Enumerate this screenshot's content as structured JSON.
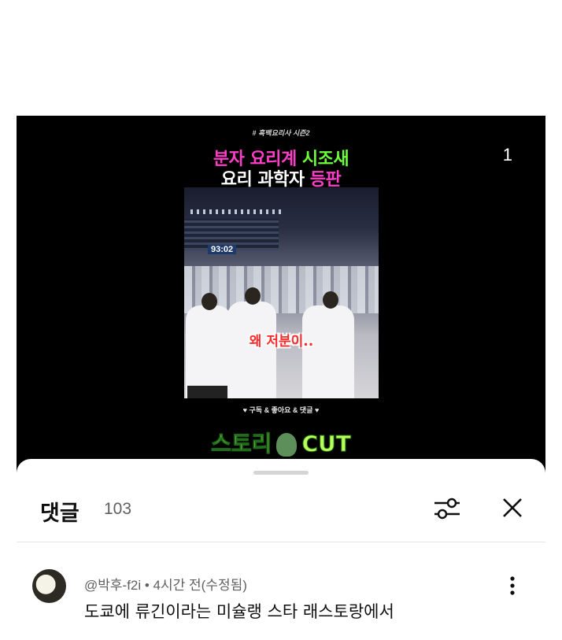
{
  "video": {
    "hashtag": "# 흑백요리사 시즌2",
    "title_line1": {
      "part1": "분자 요리계",
      "part2": "시조새"
    },
    "title_line2": {
      "part1": "요리 과학자",
      "part2": "등판"
    },
    "page_counter": "1",
    "timer": "93:02",
    "frame_caption": "왜 저분이..",
    "subscribe_line": "♥ 구독 & 좋아요 & 댓글 ♥",
    "logo": {
      "left": "스토리",
      "right": "CUT"
    }
  },
  "comments_sheet": {
    "title": "댓글",
    "count": "103",
    "comment": {
      "meta": "@박후-f2i • 4시간 전(수정됨)",
      "text": "도쿄에 류긴이라는 미슐랭 스타 래스토랑에서"
    }
  },
  "colors": {
    "magenta": "#ff3ec8",
    "green": "#6cff3a",
    "caption_red": "#ff2b2b"
  }
}
